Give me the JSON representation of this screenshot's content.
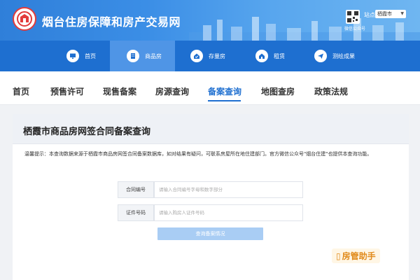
{
  "site": {
    "title": "烟台住房保障和房产交易网",
    "station_label": "站点:",
    "station_value": "栖霞市",
    "qr_caption": "微信公众号"
  },
  "main_nav": [
    {
      "label": "首页",
      "icon": "monitor-icon"
    },
    {
      "label": "商品房",
      "icon": "building-icon"
    },
    {
      "label": "存量房",
      "icon": "house-check-icon"
    },
    {
      "label": "租赁",
      "icon": "house-icon"
    },
    {
      "label": "测绘成果",
      "icon": "send-icon"
    }
  ],
  "sub_nav": [
    "首页",
    "预售许可",
    "现售备案",
    "房源查询",
    "备案查询",
    "地图查房",
    "政策法规"
  ],
  "sub_nav_active": "备案查询",
  "page": {
    "title": "栖霞市商品房网签合同备案查询",
    "tip": "温馨提示：本查询数据来源于栖霞市商品房网签合同备案数据库，如对结果有疑问，可联系房屋所在地住建部门。官方微信公众号\"烟台住建\"也提供本查询功能。"
  },
  "form": {
    "contract_label": "合同编号",
    "contract_placeholder": "请输入合同编号字母和数字部分",
    "id_label": "证件号码",
    "id_placeholder": "请输入购房人证件号码",
    "submit_label": "查询备案情况"
  },
  "watermark": "房管助手",
  "colors": {
    "primary": "#1e6fd0",
    "nav_active": "#4f95e6",
    "button": "#a9cdf4",
    "logo_red": "#e23b3b"
  }
}
